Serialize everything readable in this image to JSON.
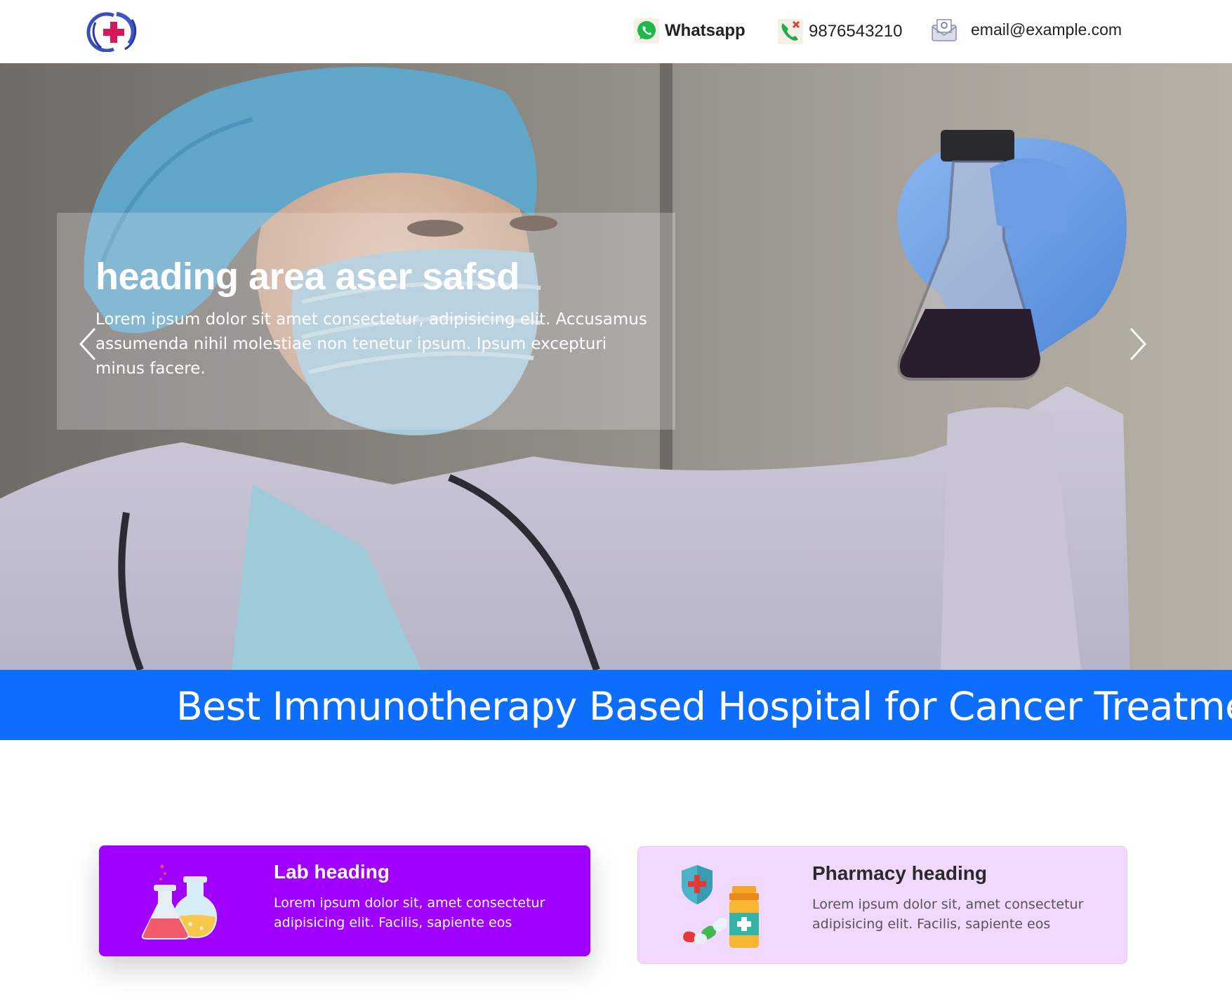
{
  "header": {
    "whatsapp_label": "Whatsapp",
    "phone": "9876543210",
    "email": "email@example.com"
  },
  "hero": {
    "heading": "heading area aser safsd",
    "text": "Lorem ipsum dolor sit amet consectetur, adipisicing elit. Accusamus assumenda nihil molestiae non tenetur ipsum. Ipsum excepturi minus facere."
  },
  "banner": {
    "text": "Best Immunotherapy Based Hospital for Cancer Treatment in"
  },
  "services": [
    {
      "title": "Lab heading",
      "text": "Lorem ipsum dolor sit, amet consectetur adipisicing elit. Facilis, sapiente eos",
      "icon": "lab-flasks-icon"
    },
    {
      "title": "Pharmacy heading",
      "text": "Lorem ipsum dolor sit, amet consectetur adipisicing elit. Facilis, sapiente eos",
      "icon": "pharmacy-icon"
    }
  ],
  "colors": {
    "banner": "#0d6efd",
    "lab_card": "#a000ff",
    "pharmacy_card": "#f1d9fe"
  }
}
